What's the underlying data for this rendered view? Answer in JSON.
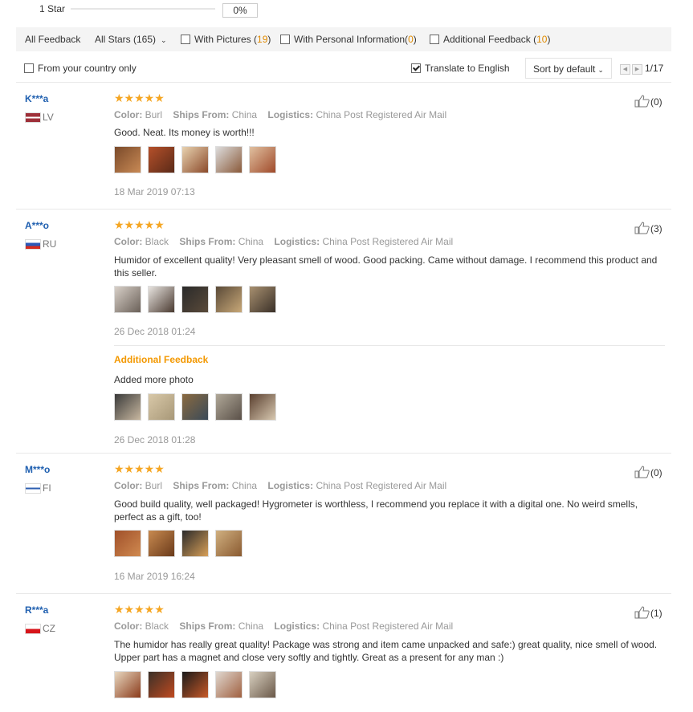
{
  "top_bar": {
    "star_label": "1 Star",
    "percent": "0%",
    "percent_fraction": 0.0
  },
  "filters": {
    "all_feedback": "All Feedback",
    "all_stars": "All Stars (165)",
    "with_pictures_label": "With Pictures (",
    "with_pictures_count": "19",
    "with_personal_label": "With Personal Information(",
    "with_personal_count": "0",
    "additional_label": "Additional Feedback (",
    "additional_count": "10",
    "close_paren": ")"
  },
  "options": {
    "from_country": "From your country only",
    "translate": "Translate to English",
    "sort": "Sort by default",
    "page": "1/17"
  },
  "reviews": [
    {
      "user": "K***a",
      "country": "LV",
      "stars": "★★★★★",
      "color_label": "Color:",
      "color": "Burl",
      "ships_label": "Ships From:",
      "ships": "China",
      "logistics_label": "Logistics:",
      "logistics": "China Post Registered Air Mail",
      "text": "Good. Neat. Its money is worth!!!",
      "date": "18 Mar 2019 07:13",
      "helpful": "(0)"
    },
    {
      "user": "A***o",
      "country": "RU",
      "stars": "★★★★★",
      "color_label": "Color:",
      "color": "Black",
      "ships_label": "Ships From:",
      "ships": "China",
      "logistics_label": "Logistics:",
      "logistics": "China Post Registered Air Mail",
      "text": "Humidor of excellent quality! Very pleasant smell of wood. Good packing. Came without damage. I recommend this product and this seller.",
      "date": "26 Dec 2018 01:24",
      "helpful": "(3)",
      "additional_title": "Additional Feedback",
      "additional_text": "Added more photo",
      "additional_date": "26 Dec 2018 01:28"
    },
    {
      "user": "M***o",
      "country": "FI",
      "stars": "★★★★★",
      "color_label": "Color:",
      "color": "Burl",
      "ships_label": "Ships From:",
      "ships": "China",
      "logistics_label": "Logistics:",
      "logistics": "China Post Registered Air Mail",
      "text": "Good build quality, well packaged! Hygrometer is worthless, I recommend you replace it with a digital one. No weird smells, perfect as a gift, too!",
      "date": "16 Mar 2019 16:24",
      "helpful": "(0)"
    },
    {
      "user": "R***a",
      "country": "CZ",
      "stars": "★★★★★",
      "color_label": "Color:",
      "color": "Black",
      "ships_label": "Ships From:",
      "ships": "China",
      "logistics_label": "Logistics:",
      "logistics": "China Post Registered Air Mail",
      "text": "The humidor has really great quality! Package was strong and item came unpacked and safe:) great quality, nice smell of wood. Upper part has a magnet and close very softly and tightly. Great as a present for any man :)",
      "helpful": "(1)"
    }
  ],
  "colors": {
    "link_blue": "#2060b0",
    "star_orange": "#f5a623",
    "accent_orange": "#f39800"
  }
}
